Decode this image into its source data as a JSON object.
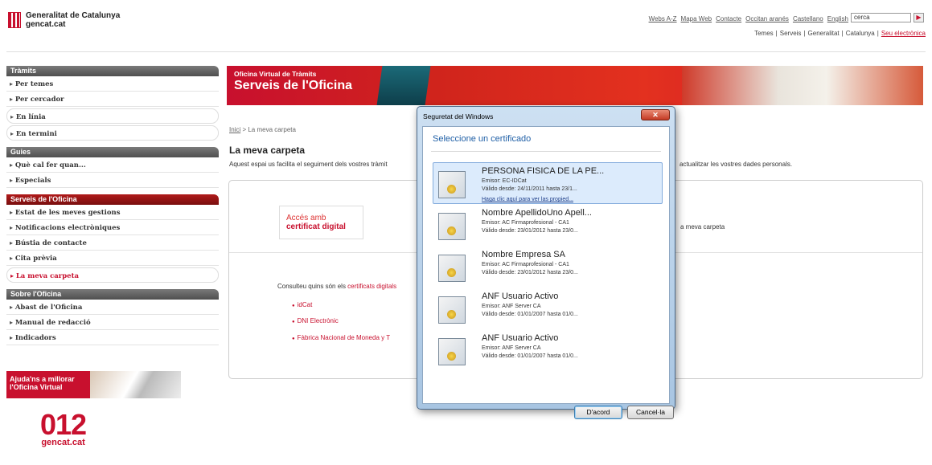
{
  "header": {
    "logo_line1": "Generalitat de Catalunya",
    "logo_line2": "gencat.cat",
    "top_links": [
      "Webs A-Z",
      "Mapa Web",
      "Contacte",
      "Occitan aranés",
      "Castellano",
      "English"
    ],
    "search_value": "cerca",
    "search_button": "▶",
    "sub_links": [
      "Temes",
      "|",
      "Serveis",
      "|",
      "Generalitat",
      "|",
      "Catalunya",
      "|"
    ],
    "seu_link": "Seu electrònica"
  },
  "sidebar": {
    "tramits": {
      "heading": "Tràmits",
      "items": [
        "Per temes",
        "Per cercador",
        "En línia",
        "En termini"
      ]
    },
    "guies": {
      "heading": "Guies",
      "items": [
        "Què cal fer quan...",
        "Especials"
      ]
    },
    "serveis": {
      "heading": "Serveis de l'Oficina",
      "items": [
        "Estat de les meves gestions",
        "Notificacions electròniques",
        "Bústia de contacte",
        "Cita prèvia",
        "La meva carpeta"
      ]
    },
    "sobre": {
      "heading": "Sobre l'Oficina",
      "items": [
        "Abast de l'Oficina",
        "Manual de redacció",
        "Indicadors"
      ]
    },
    "promo_line1": "Ajuda'ns a millorar",
    "promo_line2": "l'Oficina Virtual",
    "logo012_big": "012",
    "logo012_small": "gencat.cat"
  },
  "banner": {
    "subtitle": "Oficina Virtual de Tràmits",
    "title": "Serveis de l'Oficina"
  },
  "main": {
    "breadcrumb_home": "Inici",
    "breadcrumb_rest": " > La meva carpeta",
    "page_title": "La meva carpeta",
    "intro_left": "Aquest espai us facilita el seguiment dels vostres tràmit",
    "intro_right": "actualitzar les vostres dades personals.",
    "access_line1": "Accés amb",
    "access_line2": "certificat digital",
    "right_text": "a meva carpeta",
    "consult_text": "Consulteu quins són els ",
    "consult_link": "certificats digitals",
    "cert_links": [
      "idCat",
      "DNI Electrònic",
      "Fàbrica Nacional de Moneda y T"
    ]
  },
  "dialog": {
    "title": "Seguretat del Windows",
    "close": "✕",
    "heading": "Seleccione un certificado",
    "certs": [
      {
        "name": "PERSONA FISICA DE LA PE...",
        "issuer": "Emisor: EC-IDCat",
        "valid": "Válido desde: 24/11/2011 hasta 23/1...",
        "link": "Haga clic aquí para ver las propied..."
      },
      {
        "name": "Nombre ApellidoUno Apell...",
        "issuer": "Emisor: AC Firmaprofesional - CA1",
        "valid": "Válido desde: 23/01/2012 hasta 23/0..."
      },
      {
        "name": "Nombre Empresa SA",
        "issuer": "Emisor: AC Firmaprofesional - CA1",
        "valid": "Válido desde: 23/01/2012 hasta 23/0..."
      },
      {
        "name": "ANF Usuario Activo",
        "issuer": "Emisor: ANF Server CA",
        "valid": "Válido desde: 01/01/2007 hasta 01/0..."
      },
      {
        "name": "ANF Usuario Activo",
        "issuer": "Emisor: ANF Server CA",
        "valid": "Válido desde: 01/01/2007 hasta 01/0..."
      }
    ],
    "ok_label": "D'acord",
    "cancel_label": "Cancel·la"
  }
}
